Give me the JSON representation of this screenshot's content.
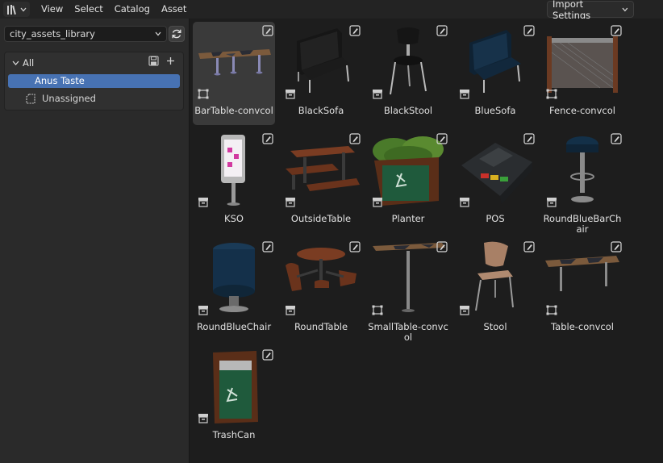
{
  "header": {
    "menu": [
      "View",
      "Select",
      "Catalog",
      "Asset"
    ],
    "import_settings": "Import Settings"
  },
  "sidebar": {
    "library": "city_assets_library",
    "catalog_root": "All",
    "catalogs": [
      {
        "label": "Anus Taste",
        "selected": true
      },
      {
        "label": "Unassigned",
        "selected": false
      }
    ]
  },
  "assets": [
    {
      "name": "BarTable-convcol",
      "type": "collection",
      "selected": true
    },
    {
      "name": "BlackSofa",
      "type": "object"
    },
    {
      "name": "BlackStool",
      "type": "object"
    },
    {
      "name": "BlueSofa",
      "type": "object"
    },
    {
      "name": "Fence-convcol",
      "type": "collection"
    },
    {
      "name": "KSO",
      "type": "object"
    },
    {
      "name": "OutsideTable",
      "type": "object"
    },
    {
      "name": "Planter",
      "type": "object"
    },
    {
      "name": "POS",
      "type": "object"
    },
    {
      "name": "RoundBlueBarChair",
      "type": "object"
    },
    {
      "name": "RoundBlueChair",
      "type": "object"
    },
    {
      "name": "RoundTable",
      "type": "object"
    },
    {
      "name": "SmallTable-convcol",
      "type": "collection"
    },
    {
      "name": "Stool",
      "type": "object"
    },
    {
      "name": "Table-convcol",
      "type": "collection"
    },
    {
      "name": "TrashCan",
      "type": "object"
    }
  ],
  "colors": {
    "accent": "#4772b3",
    "background": "#1d1d1d",
    "panel": "#2a2a2a"
  }
}
